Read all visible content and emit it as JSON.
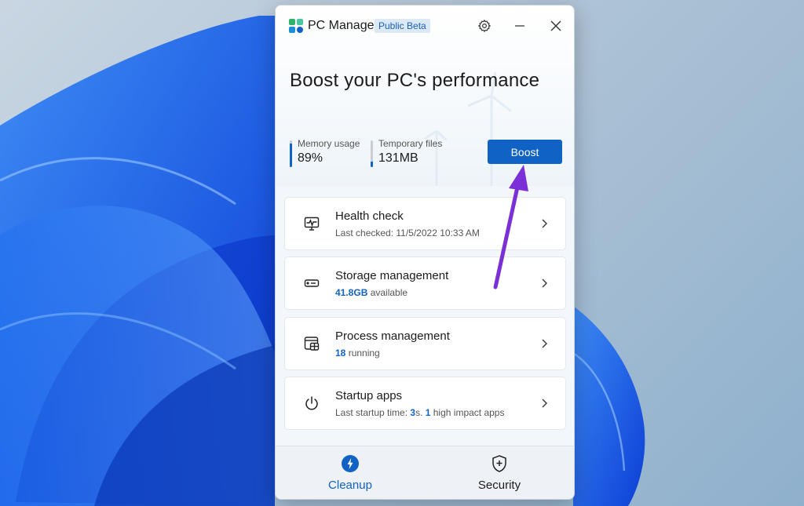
{
  "app": {
    "title": "PC Manager",
    "badge": "Public Beta"
  },
  "icons": {
    "settings": "gear-icon",
    "minimize": "minimize-icon",
    "close": "close-icon"
  },
  "hero": {
    "headline": "Boost your PC's performance"
  },
  "stats": {
    "memory": {
      "label": "Memory usage",
      "value": "89%",
      "fill_fraction": 0.89
    },
    "temp": {
      "label": "Temporary files",
      "value": "131MB",
      "fill_fraction": 0.2
    }
  },
  "boost_button": "Boost",
  "cards": {
    "health": {
      "title": "Health check",
      "subtitle": "Last checked: 11/5/2022 10:33 AM"
    },
    "storage": {
      "title": "Storage management",
      "highlight": "41.8GB",
      "rest": " available"
    },
    "process": {
      "title": "Process management",
      "highlight": "18",
      "rest": " running"
    },
    "startup": {
      "title": "Startup apps",
      "prefix": "Last startup time: ",
      "time": "3",
      "middle": "s. ",
      "count": "1",
      "suffix": " high impact apps"
    }
  },
  "nav": {
    "cleanup": "Cleanup",
    "security": "Security"
  },
  "colors": {
    "accent": "#1062c4",
    "annotation_arrow": "#7b2fd6"
  }
}
